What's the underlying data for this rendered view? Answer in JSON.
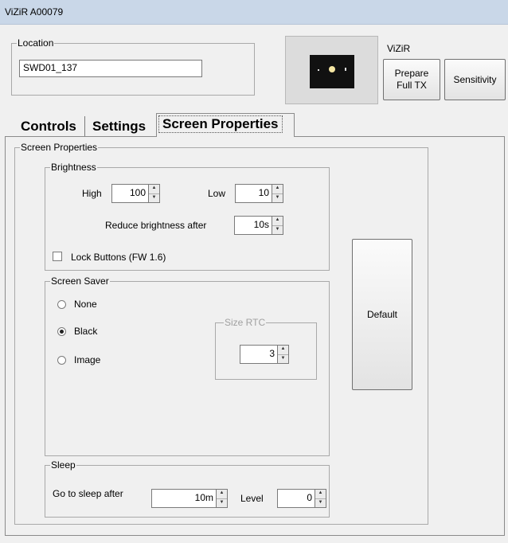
{
  "window": {
    "title": "ViZiR A00079"
  },
  "location": {
    "legend": "Location",
    "value": "SWD01_137"
  },
  "device": {
    "name": "ViZiR",
    "prepare_label_1": "Prepare",
    "prepare_label_2": "Full TX",
    "sensitivity_label": "Sensitivity"
  },
  "tabs": [
    {
      "label": "Controls"
    },
    {
      "label": "Settings"
    },
    {
      "label": "Screen Properties",
      "selected": true
    }
  ],
  "screen_properties": {
    "legend": "Screen Properties",
    "brightness": {
      "legend": "Brightness",
      "high_label": "High",
      "high_value": "100",
      "low_label": "Low",
      "low_value": "10",
      "reduce_label": "Reduce brightness after",
      "reduce_value": "10s",
      "lock_label": "Lock Buttons (FW 1.6)",
      "lock_checked": false
    },
    "screen_saver": {
      "legend": "Screen Saver",
      "options": [
        {
          "label": "None",
          "selected": false
        },
        {
          "label": "Black",
          "selected": true
        },
        {
          "label": "Image",
          "selected": false
        }
      ],
      "size_rtc_legend": "Size RTC",
      "size_rtc_value": "3"
    },
    "sleep": {
      "legend": "Sleep",
      "after_label": "Go to sleep after",
      "after_value": "10m",
      "level_label": "Level",
      "level_value": "0"
    },
    "default_label": "Default"
  }
}
